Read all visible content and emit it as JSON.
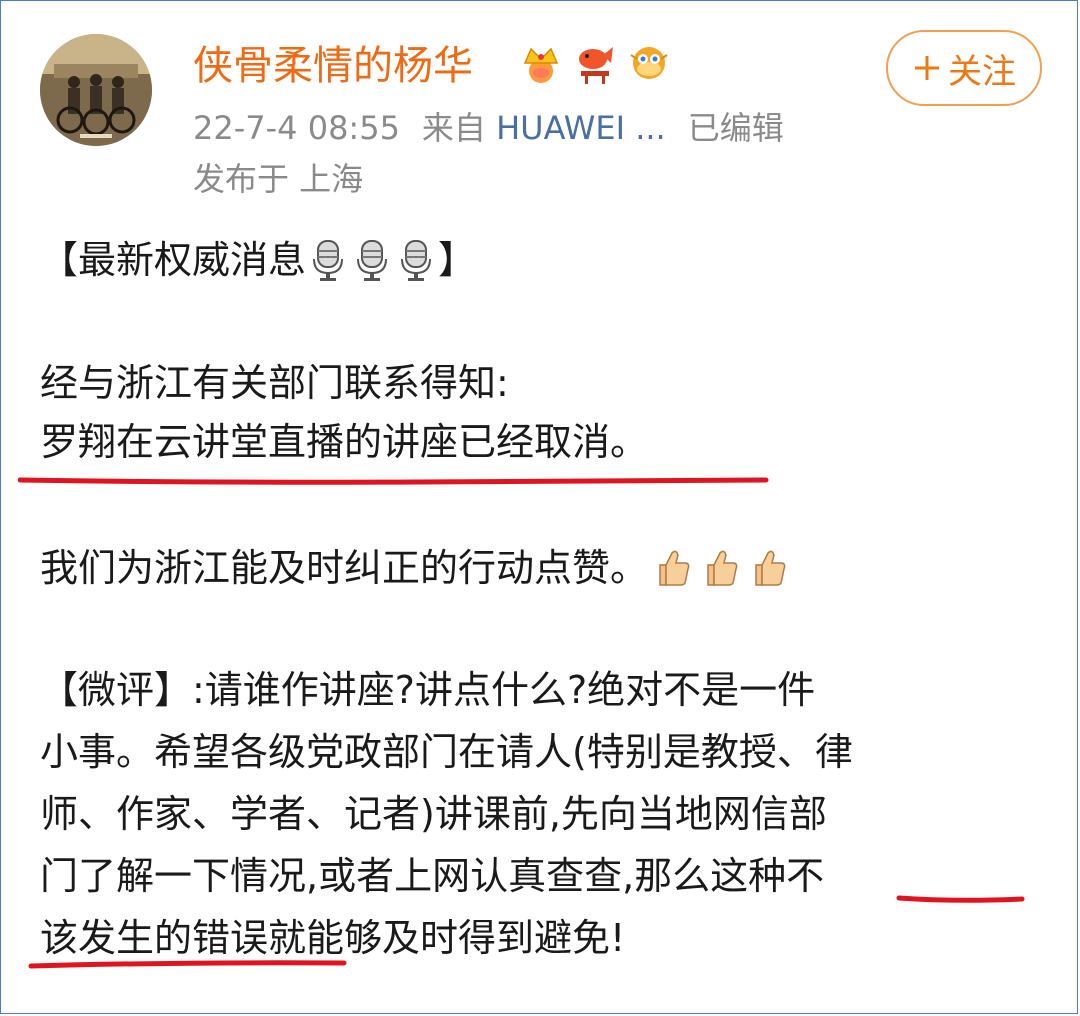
{
  "post": {
    "username": "侠骨柔情的杨华",
    "follow_label": "关注",
    "timestamp": "22-7-4 08:55",
    "source_prefix": "来自",
    "device": "HUAWEI ...",
    "edited": "已编辑",
    "location": "发布于 上海",
    "badges": [
      "crown-badge",
      "koi-badge",
      "pufferfish-badge"
    ],
    "accent_color": "#f06a13",
    "underline_color": "#e0141e"
  },
  "content": {
    "heading": "【最新权威消息",
    "heading_close": "】",
    "p1_line1": "经与浙江有关部门联系得知:",
    "p1_line2": "罗翔在云讲堂直播的讲座已经取消。",
    "p2": "我们为浙江能及时纠正的行动点赞。",
    "p3_line1": "【微评】:请谁作讲座?讲点什么?绝对不是一件",
    "p3_line2": "小事。希望各级党政部门在请人(特别是教授、律",
    "p3_line3": "师、作家、学者、记者)讲课前,先向当地网信部",
    "p3_line4": "门了解一下情况,或者上网认真查查,那么这种不",
    "p3_line5": "该发生的错误就能够及时得到避免!"
  }
}
